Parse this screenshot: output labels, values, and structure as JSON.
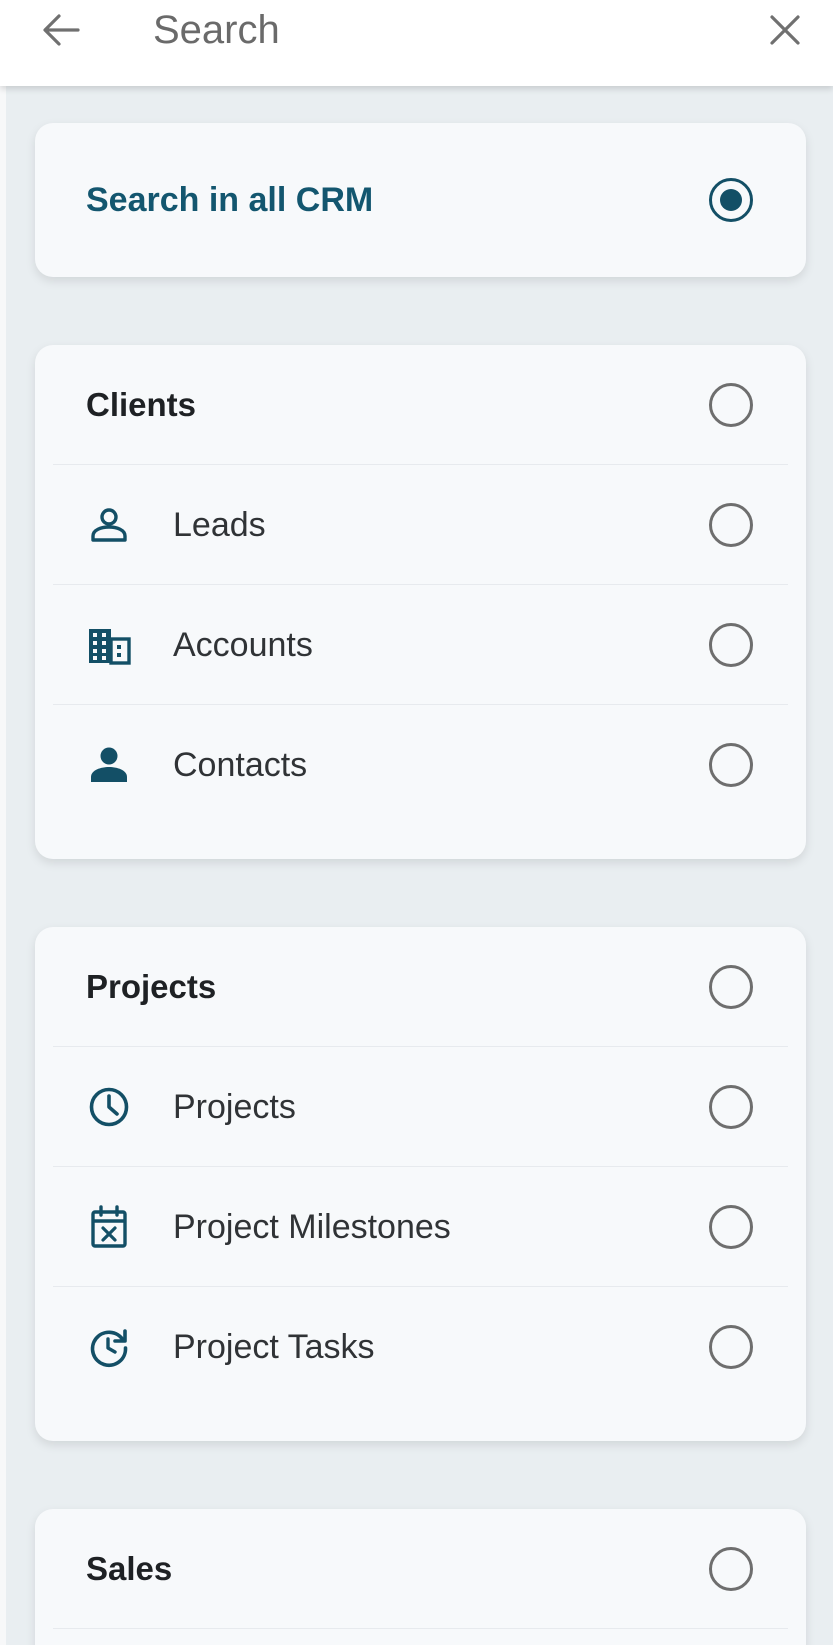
{
  "header": {
    "back_icon": "arrow-left-icon",
    "search_placeholder": "Search",
    "close_icon": "close-icon"
  },
  "colors": {
    "accent": "#134f66",
    "background": "#e9eef1",
    "card": "#f7f9fb"
  },
  "search_all": {
    "label": "Search in all CRM",
    "selected": true
  },
  "groups": [
    {
      "label": "Clients",
      "selected": false,
      "items": [
        {
          "label": "Leads",
          "icon": "person-outline-icon",
          "selected": false
        },
        {
          "label": "Accounts",
          "icon": "building-icon",
          "selected": false
        },
        {
          "label": "Contacts",
          "icon": "person-icon",
          "selected": false
        }
      ]
    },
    {
      "label": "Projects",
      "selected": false,
      "items": [
        {
          "label": "Projects",
          "icon": "clock-icon",
          "selected": false
        },
        {
          "label": "Project Milestones",
          "icon": "calendar-x-icon",
          "selected": false
        },
        {
          "label": "Project Tasks",
          "icon": "clock-refresh-icon",
          "selected": false
        }
      ]
    },
    {
      "label": "Sales",
      "selected": false,
      "items": []
    }
  ]
}
